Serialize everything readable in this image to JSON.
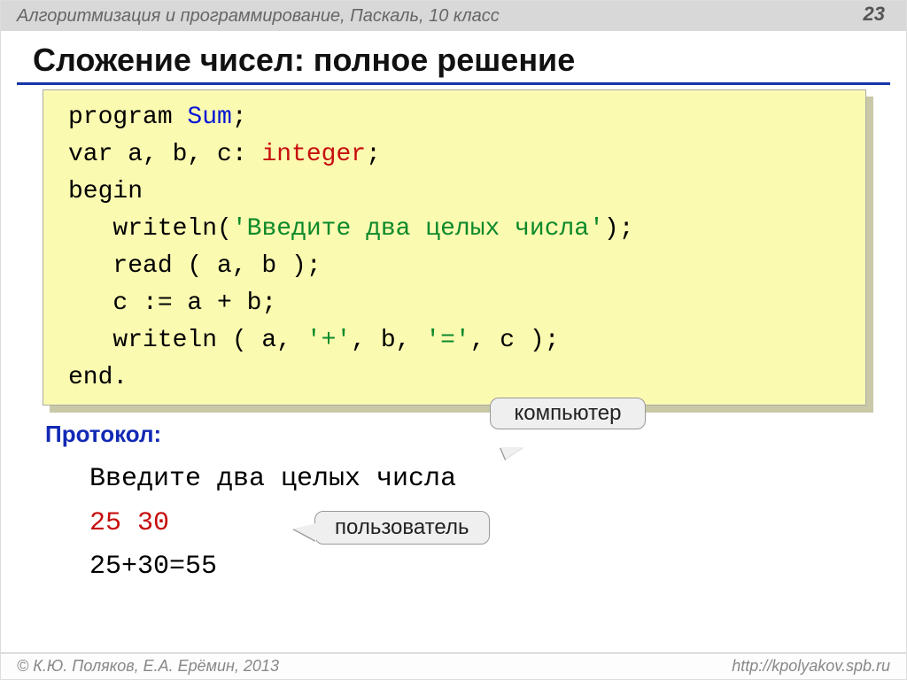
{
  "header": {
    "course": "Алгоритмизация и программирование, Паскаль, 10 класс",
    "page": "23"
  },
  "title": "Сложение чисел: полное решение",
  "code": {
    "l1_a": "program ",
    "l1_b": "Sum",
    "l1_c": ";",
    "l2_a": "var a, b, c: ",
    "l2_b": "integer",
    "l2_c": ";",
    "l3": "begin",
    "l4_a": "   writeln(",
    "l4_b": "'Введите два целых числа'",
    "l4_c": ");",
    "l5": "   read ( a, b );",
    "l6": "   c := a + b;",
    "l7_a": "   writeln ( a, ",
    "l7_b": "'+'",
    "l7_c": ", b, ",
    "l7_d": "'='",
    "l7_e": ", c );",
    "l8": "end."
  },
  "protocol": {
    "label": "Протокол:",
    "line1": "Введите два целых числа",
    "line2": "25 30",
    "line3": "25+30=55"
  },
  "callouts": {
    "computer": "компьютер",
    "user": "пользователь"
  },
  "footer": {
    "authors": "© К.Ю. Поляков, Е.А. Ерёмин, 2013",
    "url": "http://kpolyakov.spb.ru"
  }
}
